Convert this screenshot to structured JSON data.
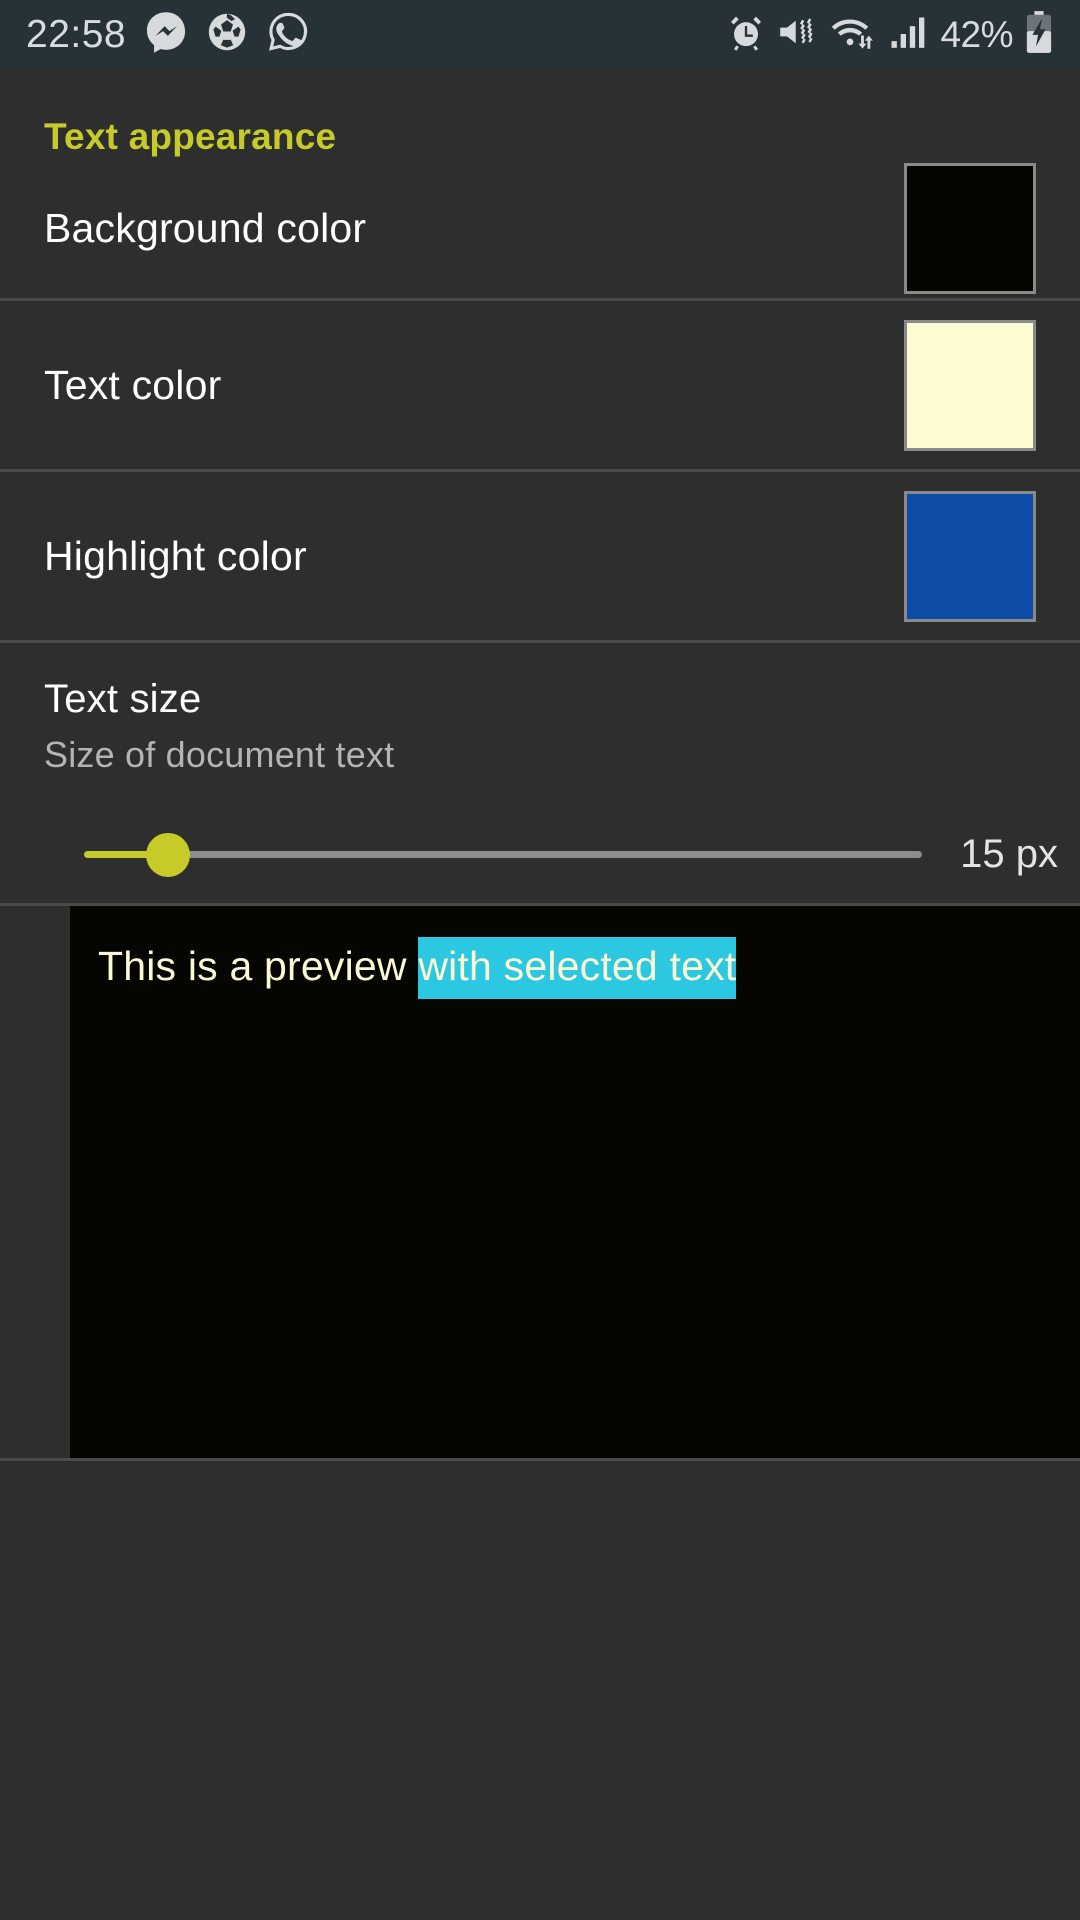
{
  "statusbar": {
    "time": "22:58",
    "battery_percent": "42%",
    "left_icons": [
      "messenger-icon",
      "soccer-ball-icon",
      "whatsapp-icon"
    ],
    "right_icons": [
      "alarm-icon",
      "vibrate-icon",
      "wifi-icon",
      "signal-icon"
    ],
    "battery_icon": "battery-charging-icon",
    "bg_color": "#273238",
    "fg_color": "#d8dcde"
  },
  "section": {
    "header": "Text appearance",
    "header_color": "#c6cb2a"
  },
  "prefs": [
    {
      "name": "background-color",
      "title": "Background color",
      "swatch": "#050602"
    },
    {
      "name": "text-color",
      "title": "Text color",
      "swatch": "#fdfbd0"
    },
    {
      "name": "highlight-color",
      "title": "Highlight color",
      "swatch": "#0d4da8"
    }
  ],
  "text_size": {
    "title": "Text size",
    "subtitle": "Size of document text",
    "value_label": "15 px",
    "value": 15,
    "accent_color": "#c6cb2a",
    "track_color": "#8d8d8d"
  },
  "preview": {
    "plain_text": "This is a preview ",
    "selected_text": "with selected text",
    "bg_color": "#050602",
    "text_color": "#fbf8d4",
    "selection_color": "#2cc7e0"
  }
}
